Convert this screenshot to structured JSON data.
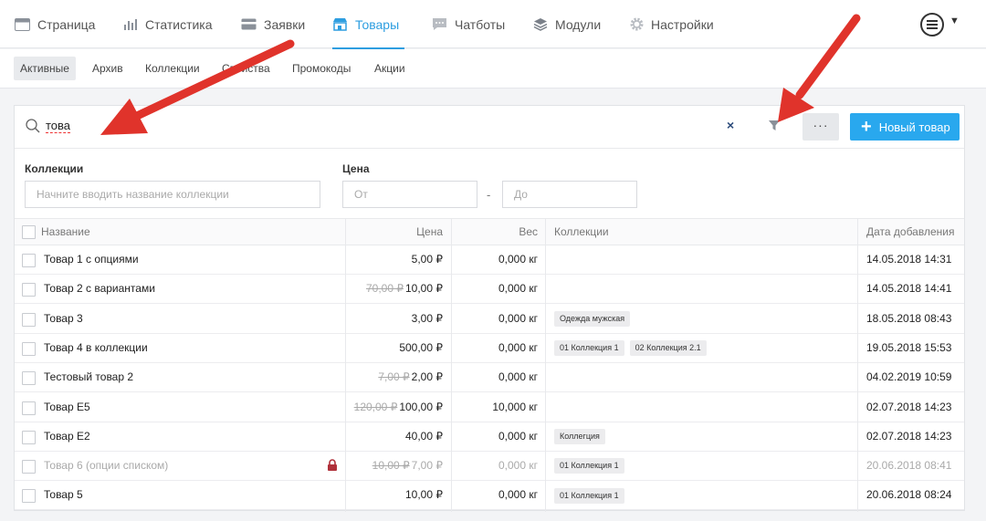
{
  "topnav": {
    "tabs": [
      {
        "label": "Страница"
      },
      {
        "label": "Статистика"
      },
      {
        "label": "Заявки"
      },
      {
        "label": "Товары"
      },
      {
        "label": "Чатботы"
      },
      {
        "label": "Модули"
      },
      {
        "label": "Настройки"
      }
    ],
    "active_color": "#2e9ee0"
  },
  "subnav": {
    "items": [
      {
        "label": "Активные"
      },
      {
        "label": "Архив"
      },
      {
        "label": "Коллекции"
      },
      {
        "label": "Свойства"
      },
      {
        "label": "Промокоды"
      },
      {
        "label": "Акции"
      }
    ]
  },
  "toolbar": {
    "search_value": "това",
    "clear_label": "×",
    "more_label": "···",
    "new_label": "Новый товар"
  },
  "filters": {
    "collections_label": "Коллекции",
    "collections_placeholder": "Начните вводить название коллекции",
    "price_label": "Цена",
    "price_from_placeholder": "От",
    "price_to_placeholder": "До",
    "price_dash": "-"
  },
  "table": {
    "headers": {
      "name": "Название",
      "price": "Цена",
      "weight": "Вес",
      "collections": "Коллекции",
      "date": "Дата добавления"
    },
    "rows": [
      {
        "name": "Товар 1 с опциями",
        "old_price": "",
        "price": "5,00 ₽",
        "weight": "0,000 кг",
        "tags": [],
        "date": "14.05.2018 14:31"
      },
      {
        "name": "Товар 2 с вариантами",
        "old_price": "70,00 ₽",
        "price": "10,00 ₽",
        "weight": "0,000 кг",
        "tags": [],
        "date": "14.05.2018 14:41"
      },
      {
        "name": "Товар 3",
        "old_price": "",
        "price": "3,00 ₽",
        "weight": "0,000 кг",
        "tags": [
          "Одежда мужская"
        ],
        "date": "18.05.2018 08:43"
      },
      {
        "name": "Товар 4 в коллекции",
        "old_price": "",
        "price": "500,00 ₽",
        "weight": "0,000 кг",
        "tags": [
          "01 Коллекция 1",
          "02 Коллекция 2.1"
        ],
        "date": "19.05.2018 15:53"
      },
      {
        "name": "Тестовый товар 2",
        "old_price": "7,00 ₽",
        "price": "2,00 ₽",
        "weight": "0,000 кг",
        "tags": [],
        "date": "04.02.2019 10:59"
      },
      {
        "name": "Товар E5",
        "old_price": "120,00 ₽",
        "price": "100,00 ₽",
        "weight": "10,000 кг",
        "tags": [],
        "date": "02.07.2018 14:23"
      },
      {
        "name": "Товар E2",
        "old_price": "",
        "price": "40,00 ₽",
        "weight": "0,000 кг",
        "tags": [
          "Коллегция"
        ],
        "date": "02.07.2018 14:23"
      },
      {
        "name": "Товар 6 (опции списком)",
        "old_price": "10,00 ₽",
        "price": "7,00 ₽",
        "weight": "0,000 кг",
        "tags": [
          "01 Коллекция 1"
        ],
        "date": "20.06.2018 08:41",
        "locked": true
      },
      {
        "name": "Товар 5",
        "old_price": "",
        "price": "10,00 ₽",
        "weight": "0,000 кг",
        "tags": [
          "01 Коллекция 1"
        ],
        "date": "20.06.2018 08:24"
      }
    ]
  },
  "colors": {
    "accent": "#29a8ee",
    "arrow": "#e0332b",
    "lock": "#b0303a"
  }
}
